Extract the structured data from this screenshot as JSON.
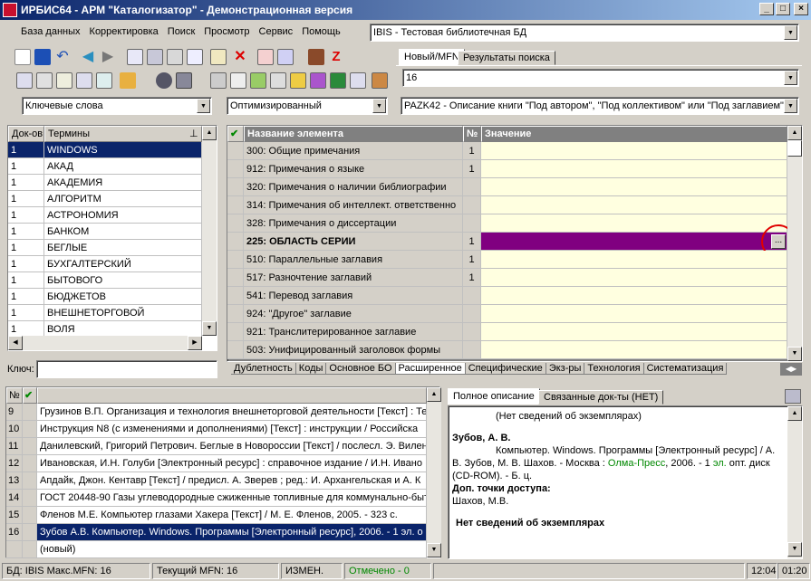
{
  "window": {
    "title": "ИРБИС64 - АРМ \"Каталогизатор\" - Демонстрационная версия"
  },
  "menu": [
    "База данных",
    "Корректировка",
    "Поиск",
    "Просмотр",
    "Сервис",
    "Помощь"
  ],
  "db_combo": "IBIS - Тестовая библиотечная БД",
  "top_tabs": [
    "Новый/MFN",
    "Результаты поиска"
  ],
  "mfn_value": "16",
  "search_mode": "Ключевые слова",
  "optimize_mode": "Оптимизированный",
  "worksheet": "PAZK42 - Описание книги \"Под автором\", \"Под коллективом\" или \"Под заглавием\"",
  "dict": {
    "headers": [
      "Док-ов",
      "Термины"
    ],
    "rows": [
      {
        "count": "1",
        "term": "WINDOWS"
      },
      {
        "count": "1",
        "term": "АКАД"
      },
      {
        "count": "1",
        "term": "АКАДЕМИЯ"
      },
      {
        "count": "1",
        "term": "АЛГОРИТМ"
      },
      {
        "count": "1",
        "term": "АСТРОНОМИЯ"
      },
      {
        "count": "1",
        "term": "БАНКОМ"
      },
      {
        "count": "1",
        "term": "БЕГЛЫЕ"
      },
      {
        "count": "1",
        "term": "БУХГАЛТЕРСКИЙ"
      },
      {
        "count": "1",
        "term": "БЫТОВОГО"
      },
      {
        "count": "1",
        "term": "БЮДЖЕТОВ"
      },
      {
        "count": "1",
        "term": "ВНЕШНЕТОРГОВОЙ"
      },
      {
        "count": "1",
        "term": "ВОЛЯ"
      }
    ],
    "key_label": "Ключ:"
  },
  "fields": {
    "headers": [
      "Название элемента",
      "№",
      "Значение"
    ],
    "rows": [
      {
        "name": "300: Общие примечания",
        "num": "1"
      },
      {
        "name": "912: Примечания о языке",
        "num": "1"
      },
      {
        "name": "320: Примечания о наличии библиографии",
        "num": ""
      },
      {
        "name": "314: Примечания об интеллект. ответственно",
        "num": ""
      },
      {
        "name": "328: Примечания о диссертации",
        "num": ""
      },
      {
        "name": "225: ОБЛАСТЬ СЕРИИ",
        "num": "1"
      },
      {
        "name": "510: Параллельные заглавия",
        "num": "1"
      },
      {
        "name": "517: Разночтение заглавий",
        "num": "1"
      },
      {
        "name": "541: Перевод заглавия",
        "num": ""
      },
      {
        "name": "924: \"Другое\" заглавие",
        "num": ""
      },
      {
        "name": "921: Транслитерированное заглавие",
        "num": ""
      },
      {
        "name": "503: Унифицированный заголовок формы",
        "num": ""
      }
    ],
    "ellipsis": "...",
    "tabs": [
      "Дублетность",
      "Коды",
      "Основное БО",
      "Расширенное",
      "Специфические",
      "Экз-ры",
      "Технология",
      "Систематизация"
    ]
  },
  "records": {
    "header_no": "№",
    "rows": [
      {
        "n": "9",
        "text": "Грузинов В.П. Организация и технология внешнеторговой деятельности [Текст] : Те"
      },
      {
        "n": "10",
        "text": "Инструкция N8  (с изменениями и дополнениями) [Текст] : инструкции / Российска"
      },
      {
        "n": "11",
        "text": "Данилевский, Григорий Петрович. Беглые в Новороссии [Текст] / послесл. Э. Вилен"
      },
      {
        "n": "12",
        "text": "Ивановская, И.Н. Голуби [Электронный ресурс] : справочное издание / И.Н. Ивано"
      },
      {
        "n": "13",
        "text": "Апдайк, Джон. Кентавр [Текст] / предисл. А. Зверев ; ред.: И. Архангельская и А. К"
      },
      {
        "n": "14",
        "text": "ГОСТ 20448-90 Газы углеводородные сжиженные топливные для коммунально-быт"
      },
      {
        "n": "15",
        "text": "Фленов М.Е. Компьютер глазами Хакера [Текст] / М. Е. Фленов, 2005. - 323 с."
      },
      {
        "n": "16",
        "text": "Зубов А.В. Компьютер. Windows. Программы [Электронный ресурс], 2006. - 1 эл. о"
      },
      {
        "n": "",
        "text": "(новый)"
      }
    ]
  },
  "preview": {
    "tabs": [
      "Полное описание",
      "Связанные док-ты (НЕТ)"
    ],
    "line_no_copies_top": "(Нет сведений об экземплярах)",
    "author": "Зубов, А. В.",
    "desc_1": "Компьютер. Windows. Программы [Электронный ресурс] / А.",
    "desc_2": "В. Зубов, М. В. Шахов. - Москва : ",
    "publisher": "Олма-Пресс",
    "desc_3": ", 2006. - 1 ",
    "el": "эл.",
    "desc_4": " опт. диск",
    "desc_5": "(CD-ROM). - Б. ц.",
    "access_label": "Доп. точки доступа:",
    "access_value": "Шахов, М.В.",
    "no_copies": "Нет сведений об экземплярах"
  },
  "statusbar": {
    "db": "БД: IBIS Макс.MFN: 16",
    "current": "Текущий MFN: 16",
    "changed": "ИЗМЕН.",
    "marked": "Отмечено - 0",
    "time": "12:04",
    "time2": "01:20"
  },
  "colors": {
    "selection": "#0a246a",
    "field_value_bg": "#ffffe0",
    "selected_field": "#800080",
    "highlight_circle": "#e00000",
    "green": "#008000"
  }
}
